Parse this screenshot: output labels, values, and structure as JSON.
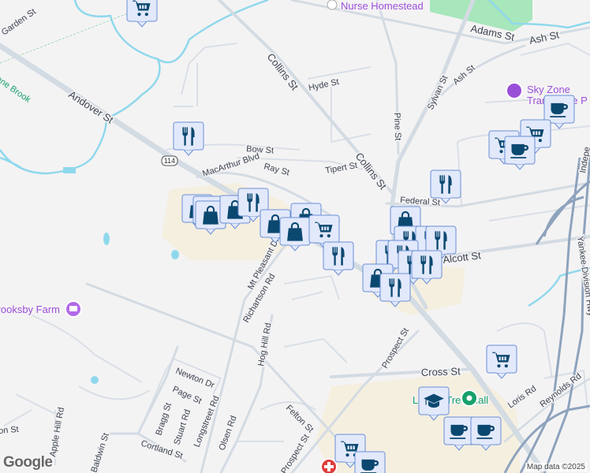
{
  "map": {
    "streets": {
      "garden": "Garden St",
      "andover": "Andover St",
      "collins1": "Collins St",
      "collins2": "Collins St",
      "hyde": "Hyde St",
      "pine": "Pine St",
      "sylvan": "Sylvan St",
      "adams": "Adams St",
      "ash1": "Ash St",
      "ash2": "Ash St",
      "bow": "Bow St",
      "ray": "Ray St",
      "macarthur": "MacArthur Blvd",
      "tipert": "Tipert St",
      "federal": "Federal St",
      "alcott": "Alcott St",
      "indep": "Indepe",
      "yankee": "Yankee Division Hwy",
      "mtpleasant": "Mt Pleasant Dr",
      "richardson": "Richartson Rd",
      "hoghill": "Hog Hill Rd",
      "newton": "Newton Dr",
      "page": "Page St",
      "bragg": "Bragg St",
      "stuart": "Stuart Rd",
      "longstreet": "Longstreet Rd",
      "olsen": "Olsen Rd",
      "cortland": "Cortland St",
      "felton": "Felton St",
      "applehill": "Apple Hill Rd",
      "baldwin": "Baldwin St",
      "eton": "Eton St",
      "prospect1": "Prospect St",
      "prospect2": "Prospect St",
      "cross": "Cross St",
      "loris": "Loris Rd",
      "reynolds": "Reynolds Rd",
      "route": "114"
    },
    "water": {
      "crane_brook": "Crane Brook"
    },
    "pois": {
      "nurse": "Nurse Homestead",
      "skyzone_line1": "Sky Zone",
      "skyzone_line2": "Trampoline P",
      "brooksby": "Brooksby Farm",
      "liberty": "Liberty Tree Mall"
    },
    "attribution": "Map data ©2025",
    "logo": "Google"
  },
  "colors": {
    "background": "#f4f3f4",
    "road": "#d3dbe3",
    "highway": "#8ea3bd",
    "water": "#8fd8ec",
    "park": "#a8e6bc",
    "commercial": "#f5efe0",
    "marker_fill": "#e2e9fb",
    "marker_icon": "#0b4870",
    "poi_purple": "#9a4fd8"
  },
  "markers": [
    {
      "type": "cart-icon"
    },
    {
      "type": "fork-knife-icon"
    },
    {
      "type": "shopping-bag-icon"
    },
    {
      "type": "coffee-cup-icon"
    },
    {
      "type": "graduation-cap-icon"
    }
  ]
}
